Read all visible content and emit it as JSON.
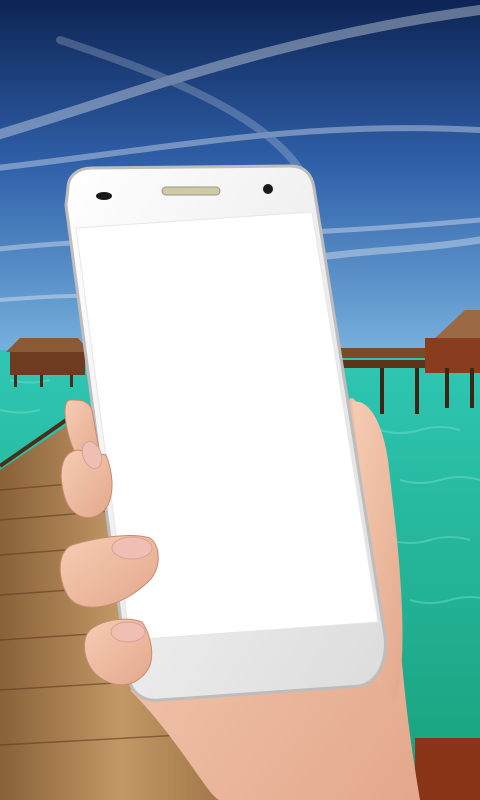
{
  "scene": {
    "description_tags": [
      "sky-background",
      "overwater-bungalows",
      "turquoise-sea",
      "wooden-pier",
      "hand-holding-phone"
    ],
    "colors": {
      "sky_top": "#0d2454",
      "sky_mid": "#2f5fa8",
      "sky_low": "#6aa6d8",
      "sea_far": "#2fc7b4",
      "sea_near": "#1fb08c",
      "pier_light": "#b48a58",
      "pier_dark": "#6b4a2a",
      "bungalow": "#7a3e22",
      "phone_body": "#f4f4f4",
      "phone_screen": "#ffffff",
      "skin_light": "#f2c3a8",
      "skin_shadow": "#d99a7e",
      "nail": "#f0bfb3"
    }
  },
  "phone": {
    "screen_content": ""
  }
}
